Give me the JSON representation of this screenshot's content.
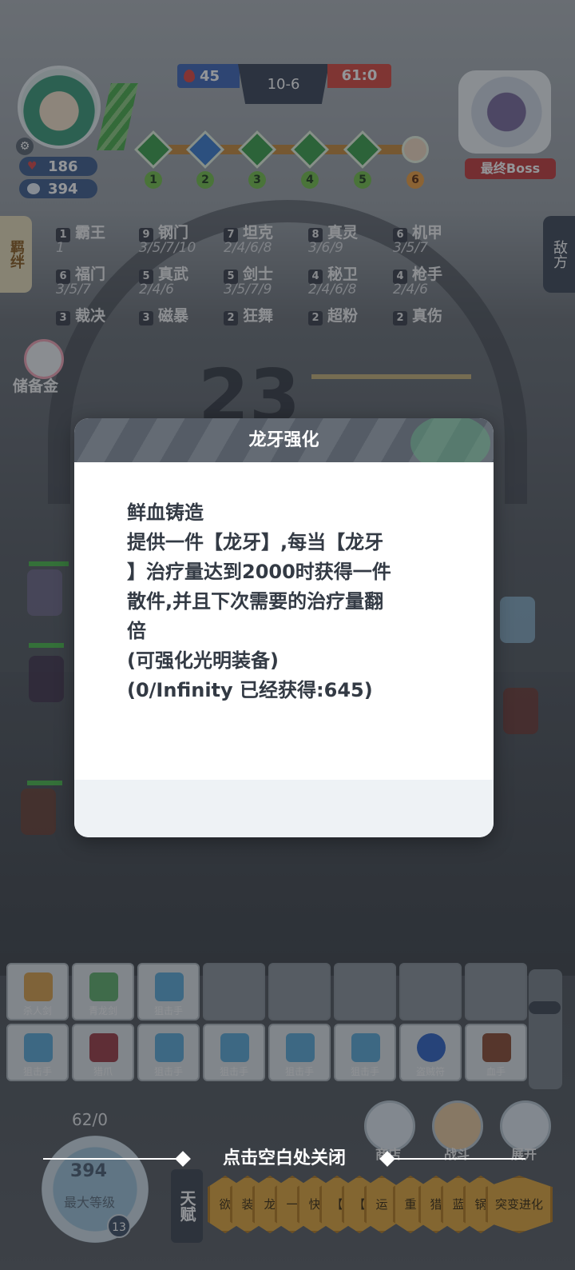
{
  "hud": {
    "hp": "186",
    "coins": "394",
    "score_blue": "45",
    "round": "10-6",
    "score_red": "61:0",
    "boss_label": "最终Boss",
    "stage_nodes": [
      "1",
      "2",
      "3",
      "4",
      "5",
      "6"
    ]
  },
  "side_tabs": {
    "left": "羁绊",
    "right": "敌方"
  },
  "synergies": [
    {
      "count": "1",
      "name": "霸王",
      "sub": "1"
    },
    {
      "count": "9",
      "name": "钢门",
      "sub": "3/5/7/10"
    },
    {
      "count": "7",
      "name": "坦克",
      "sub": "2/4/6/8"
    },
    {
      "count": "8",
      "name": "真灵",
      "sub": "3/6/9"
    },
    {
      "count": "6",
      "name": "机甲",
      "sub": "3/5/7"
    },
    {
      "count": "6",
      "name": "福门",
      "sub": "3/5/7"
    },
    {
      "count": "5",
      "name": "真武",
      "sub": "2/4/6"
    },
    {
      "count": "5",
      "name": "剑士",
      "sub": "3/5/7/9"
    },
    {
      "count": "4",
      "name": "秘卫",
      "sub": "2/4/6/8"
    },
    {
      "count": "4",
      "name": "枪手",
      "sub": "2/4/6"
    },
    {
      "count": "3",
      "name": "裁决",
      "sub": ""
    },
    {
      "count": "3",
      "name": "磁暴",
      "sub": ""
    },
    {
      "count": "2",
      "name": "狂舞",
      "sub": ""
    },
    {
      "count": "2",
      "name": "超粉",
      "sub": ""
    },
    {
      "count": "2",
      "name": "真伤",
      "sub": ""
    }
  ],
  "savings_label": "储备金",
  "countdown": "23",
  "bench": {
    "row1": [
      "杀人剑",
      "青龙剑",
      "狙击手",
      "",
      "",
      "",
      "",
      ""
    ],
    "row2": [
      "狙击手",
      "猎爪",
      "狙击手",
      "狙击手",
      "狙击手",
      "狙击手",
      "盗贼符",
      "血手"
    ]
  },
  "bottom": {
    "level_top": "62/0",
    "level_coins": "394",
    "level_label": "最大等级",
    "level_badge": "13",
    "shop_label": "商店",
    "battle_label": "战斗",
    "expand_label": "展开",
    "talent_tab": "天赋",
    "talents": [
      "欲",
      "装",
      "龙",
      "一",
      "快",
      "【",
      "【",
      "运",
      "重",
      "猎",
      "蓝",
      "锅",
      "突变进化"
    ]
  },
  "modal": {
    "title": "龙牙强化",
    "lines": [
      "鲜血铸造",
      "提供一件【龙牙】,每当【龙牙",
      "】治疗量达到2000时获得一件",
      "散件,并且下次需要的治疗量翻",
      "倍",
      "(可强化光明装备)",
      "(0/Infinity 已经获得:645)"
    ]
  },
  "close_hint": "点击空白处关闭",
  "colors": {
    "overlay": "#1e2228",
    "modal_header": "#555c66",
    "modal_text": "#333a44",
    "team_blue": "#3f67b8",
    "team_red": "#d8473f"
  }
}
